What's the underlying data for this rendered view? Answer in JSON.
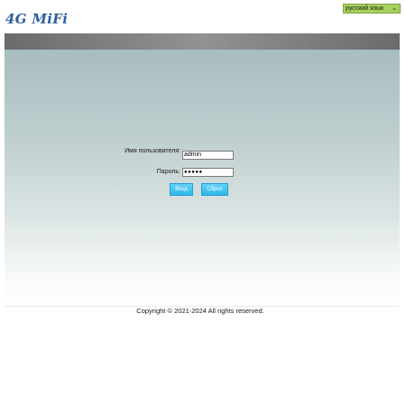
{
  "header": {
    "logo_text": "4G MiFi",
    "language_selected": "русский язык"
  },
  "login": {
    "username_label": "Имя пользователя:",
    "username_value": "admin",
    "password_label": "Пароль:",
    "password_value": "●●●●●",
    "login_button": "Вход",
    "reset_button": "Сброс"
  },
  "footer": {
    "copyright": "Copyright © 2021-2024 All rights reserved."
  },
  "colors": {
    "brand": "#2d5e9c",
    "language_select": "#a6d15c",
    "button": "#2fb6ea",
    "header_bar": "#7a7a7a"
  },
  "icons": {
    "language_dropdown": "chevron-down-icon"
  }
}
